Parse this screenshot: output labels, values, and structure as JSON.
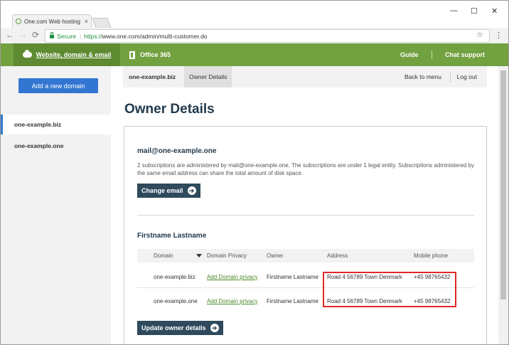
{
  "browser": {
    "tab_title": "One.com Web hosting",
    "tab_close": "×",
    "window_minimize": "—",
    "window_maximize": "☐",
    "window_close": "✕",
    "back": "←",
    "forward": "→",
    "reload": "⟳",
    "secure_label": "Secure",
    "url_scheme": "https://",
    "url_rest": "www.one.com/admin/multi-customer.do",
    "bookmark_star": "☆",
    "menu_kebab": "⋮"
  },
  "topnav": {
    "website": "Website, domain & email",
    "office": "Office 365",
    "guide": "Guide",
    "chat": "Chat support"
  },
  "sidebar": {
    "add_domain": "Add a new domain",
    "items": [
      {
        "label": "one-example.biz"
      },
      {
        "label": "one-example.one"
      }
    ]
  },
  "subnav": {
    "domain": "one-example.biz",
    "owner_details": "Owner Details",
    "back": "Back to menu",
    "logout": "Log out"
  },
  "page": {
    "title": "Owner Details"
  },
  "email_section": {
    "title": "mail@one-example.one",
    "description": "2 subscriptions are administered by mail@one-example.one. The subscriptions are under 1 legal entity. Subscriptions administered by the same email address can share the total amount of disk space.",
    "button": "Change email",
    "button_arrow": "➔"
  },
  "owner_section": {
    "title": "Firstname Lastname",
    "columns": [
      "Domain",
      "Domain Privacy",
      "Owner",
      "Address",
      "Mobile phone"
    ],
    "rows": [
      {
        "domain": "one-example.biz",
        "privacy": "Add Domain privacy",
        "owner": "Firstname Lastname",
        "address": "Road 4 56789 Town Denmark",
        "phone": "+45 98765432"
      },
      {
        "domain": "one-example.one",
        "privacy": "Add Domain privacy",
        "owner": "Firstname Lastname",
        "address": "Road 4 56789 Town Denmark",
        "phone": "+45 98765432"
      }
    ],
    "button": "Update owner details",
    "button_arrow": "➔"
  },
  "colors": {
    "brand_green": "#72a140",
    "primary_blue": "#3276d1",
    "dark_button": "#2e4a5c",
    "highlight_red": "#e32626"
  }
}
